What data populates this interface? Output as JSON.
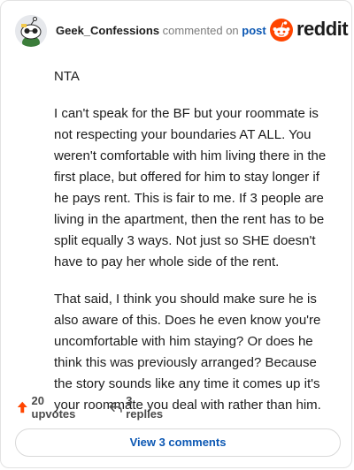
{
  "header": {
    "username": "Geek_Confessions",
    "action": "commented on",
    "target": "post",
    "logo_text": "reddit",
    "avatar_icon": "snoo-avatar-icon",
    "logo_icon": "reddit-logo-icon"
  },
  "comment": {
    "paragraphs": [
      "NTA",
      "I can't speak for the BF but your roommate is not respecting your boundaries AT ALL. You weren't comfortable with him living there in the first place, but offered for him to stay longer if he pays rent. This is fair to me. If 3 people are living in the apartment, then the rent has to be split equally 3 ways. Not just so SHE doesn't have to pay her whole side of the rent.",
      "That said, I think you should make sure he is also aware of this. Does he even know you're uncomfortable with him staying? Or does he think this was previously arranged? Because the story sounds like any time it comes up it's your roommate you deal with rather than him."
    ]
  },
  "footer": {
    "upvotes_label": "20 upvotes",
    "replies_label": "3 replies",
    "upvote_icon": "upvote-arrow-icon",
    "reply_icon": "reply-arrow-icon"
  },
  "view_button_label": "View 3 comments",
  "colors": {
    "reddit_orange": "#ff4500",
    "link_blue": "#0b57b3",
    "text": "#1c1c1c",
    "muted": "#7c7c7c"
  }
}
